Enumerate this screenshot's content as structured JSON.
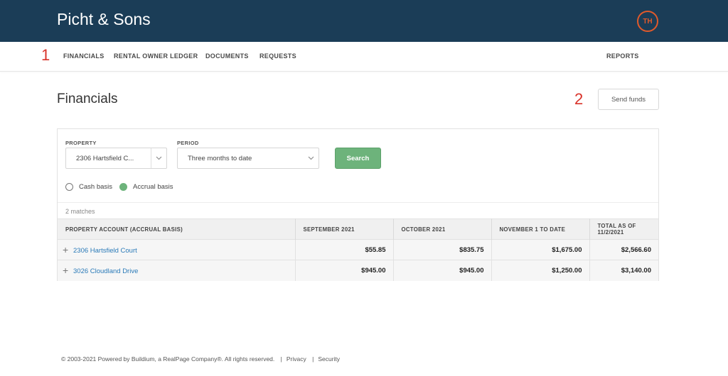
{
  "header": {
    "brand": "Picht & Sons",
    "avatar_initials": "TH"
  },
  "nav": {
    "items": [
      "FINANCIALS",
      "RENTAL OWNER LEDGER",
      "DOCUMENTS",
      "REQUESTS"
    ],
    "right_item": "REPORTS"
  },
  "annotations": {
    "nav_marker": "1",
    "send_marker": "2"
  },
  "page": {
    "title": "Financials",
    "send_funds_label": "Send funds"
  },
  "filters": {
    "property_label": "PROPERTY",
    "property_value": "2306 Hartsfield C...",
    "period_label": "PERIOD",
    "period_value": "Three months to date",
    "search_label": "Search",
    "basis_options": [
      "Cash basis",
      "Accrual basis"
    ],
    "selected_basis": "Accrual basis"
  },
  "results": {
    "matches_text": "2 matches",
    "columns": [
      "PROPERTY ACCOUNT (ACCRUAL BASIS)",
      "SEPTEMBER 2021",
      "OCTOBER 2021",
      "NOVEMBER 1 TO DATE",
      "TOTAL AS OF 11/2/2021"
    ],
    "rows": [
      {
        "account": "2306 Hartsfield Court",
        "sep": "$55.85",
        "oct": "$835.75",
        "nov": "$1,675.00",
        "total": "$2,566.60"
      },
      {
        "account": "3026 Cloudland Drive",
        "sep": "$945.00",
        "oct": "$945.00",
        "nov": "$1,250.00",
        "total": "$3,140.00"
      }
    ]
  },
  "footer": {
    "copyright": "© 2003-2021 Powered by Buildium, a RealPage Company®. All rights reserved.",
    "privacy": "Privacy",
    "security": "Security"
  },
  "colors": {
    "header_bg": "#1b3d57",
    "accent_green": "#6db37b",
    "link_blue": "#2a7ab8",
    "annotation_red": "#d9332a"
  }
}
